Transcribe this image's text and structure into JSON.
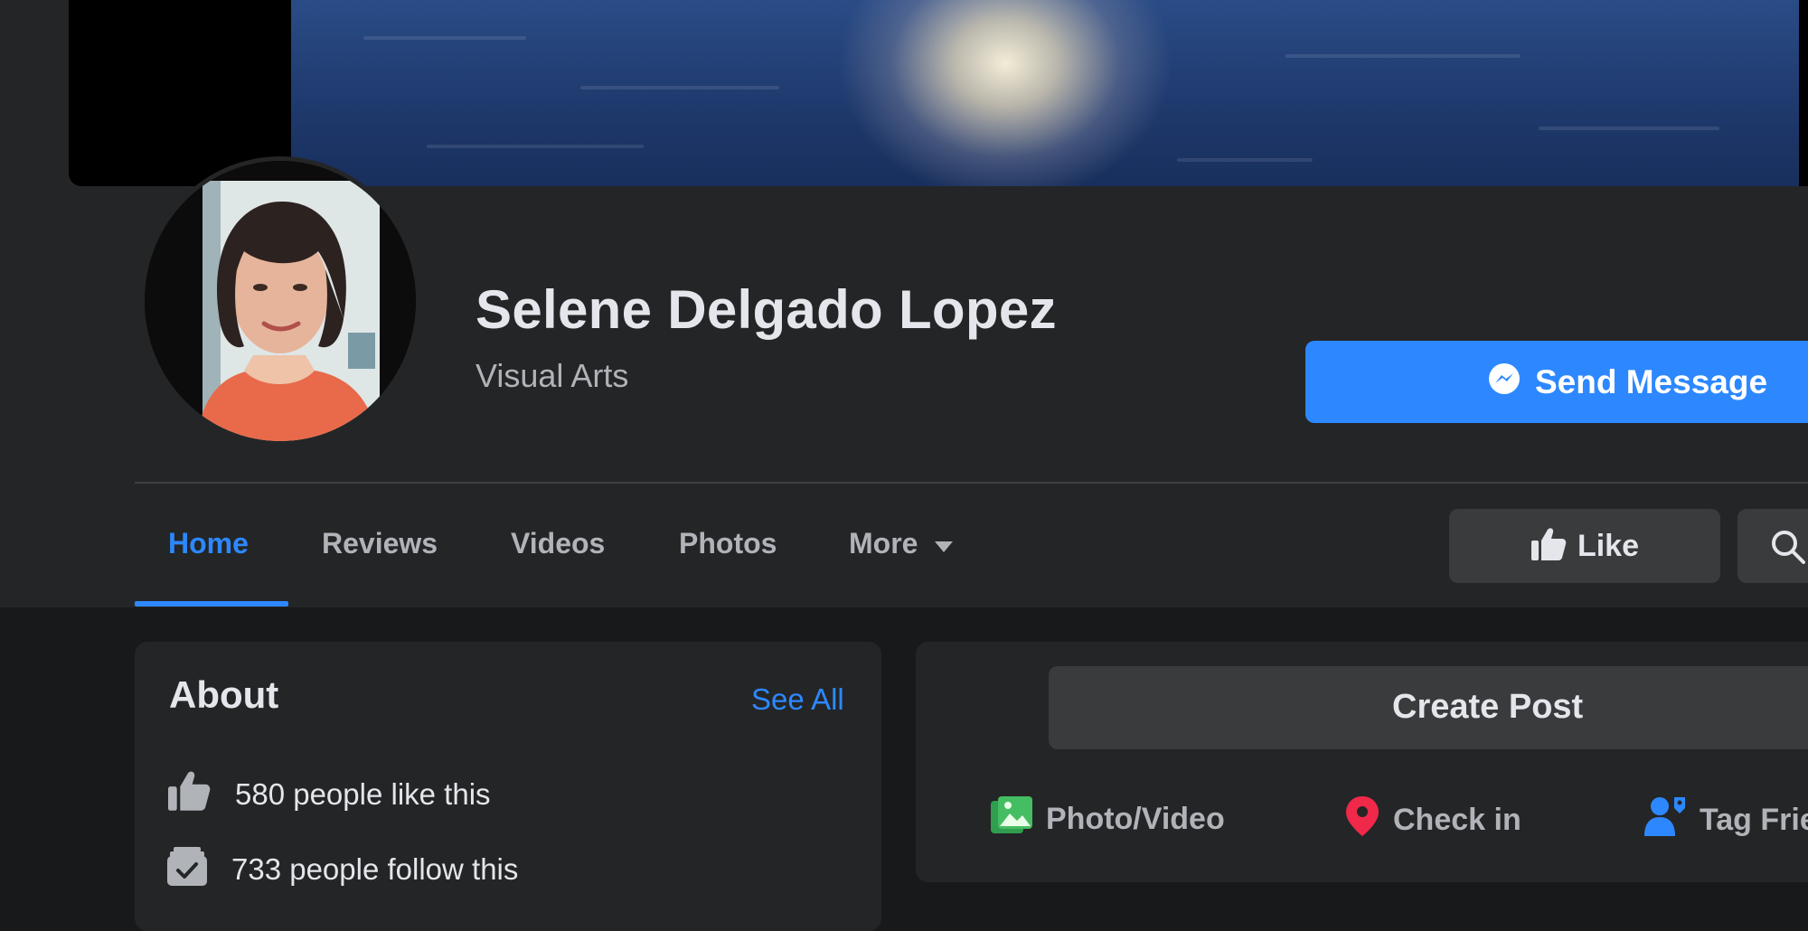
{
  "page": {
    "name": "Selene Delgado Lopez",
    "category": "Visual Arts",
    "send_message_label": "Send Message"
  },
  "tabs": [
    {
      "label": "Home",
      "active": true
    },
    {
      "label": "Reviews",
      "active": false
    },
    {
      "label": "Videos",
      "active": false
    },
    {
      "label": "Photos",
      "active": false
    },
    {
      "label": "More",
      "active": false
    }
  ],
  "actions": {
    "like_label": "Like",
    "search_icon": "search-icon"
  },
  "about": {
    "title": "About",
    "see_all": "See All",
    "likes_text": "580 people like this",
    "follows_text": "733 people follow this"
  },
  "composer": {
    "create_post_label": "Create Post",
    "photo_video_label": "Photo/Video",
    "check_in_label": "Check in",
    "tag_friends_label": "Tag Frie"
  },
  "colors": {
    "background": "#18191a",
    "panel": "#242526",
    "accent": "#2d88ff",
    "button_gray": "#3a3b3c",
    "photo_green": "#45bd62",
    "checkin_red": "#f02849"
  }
}
